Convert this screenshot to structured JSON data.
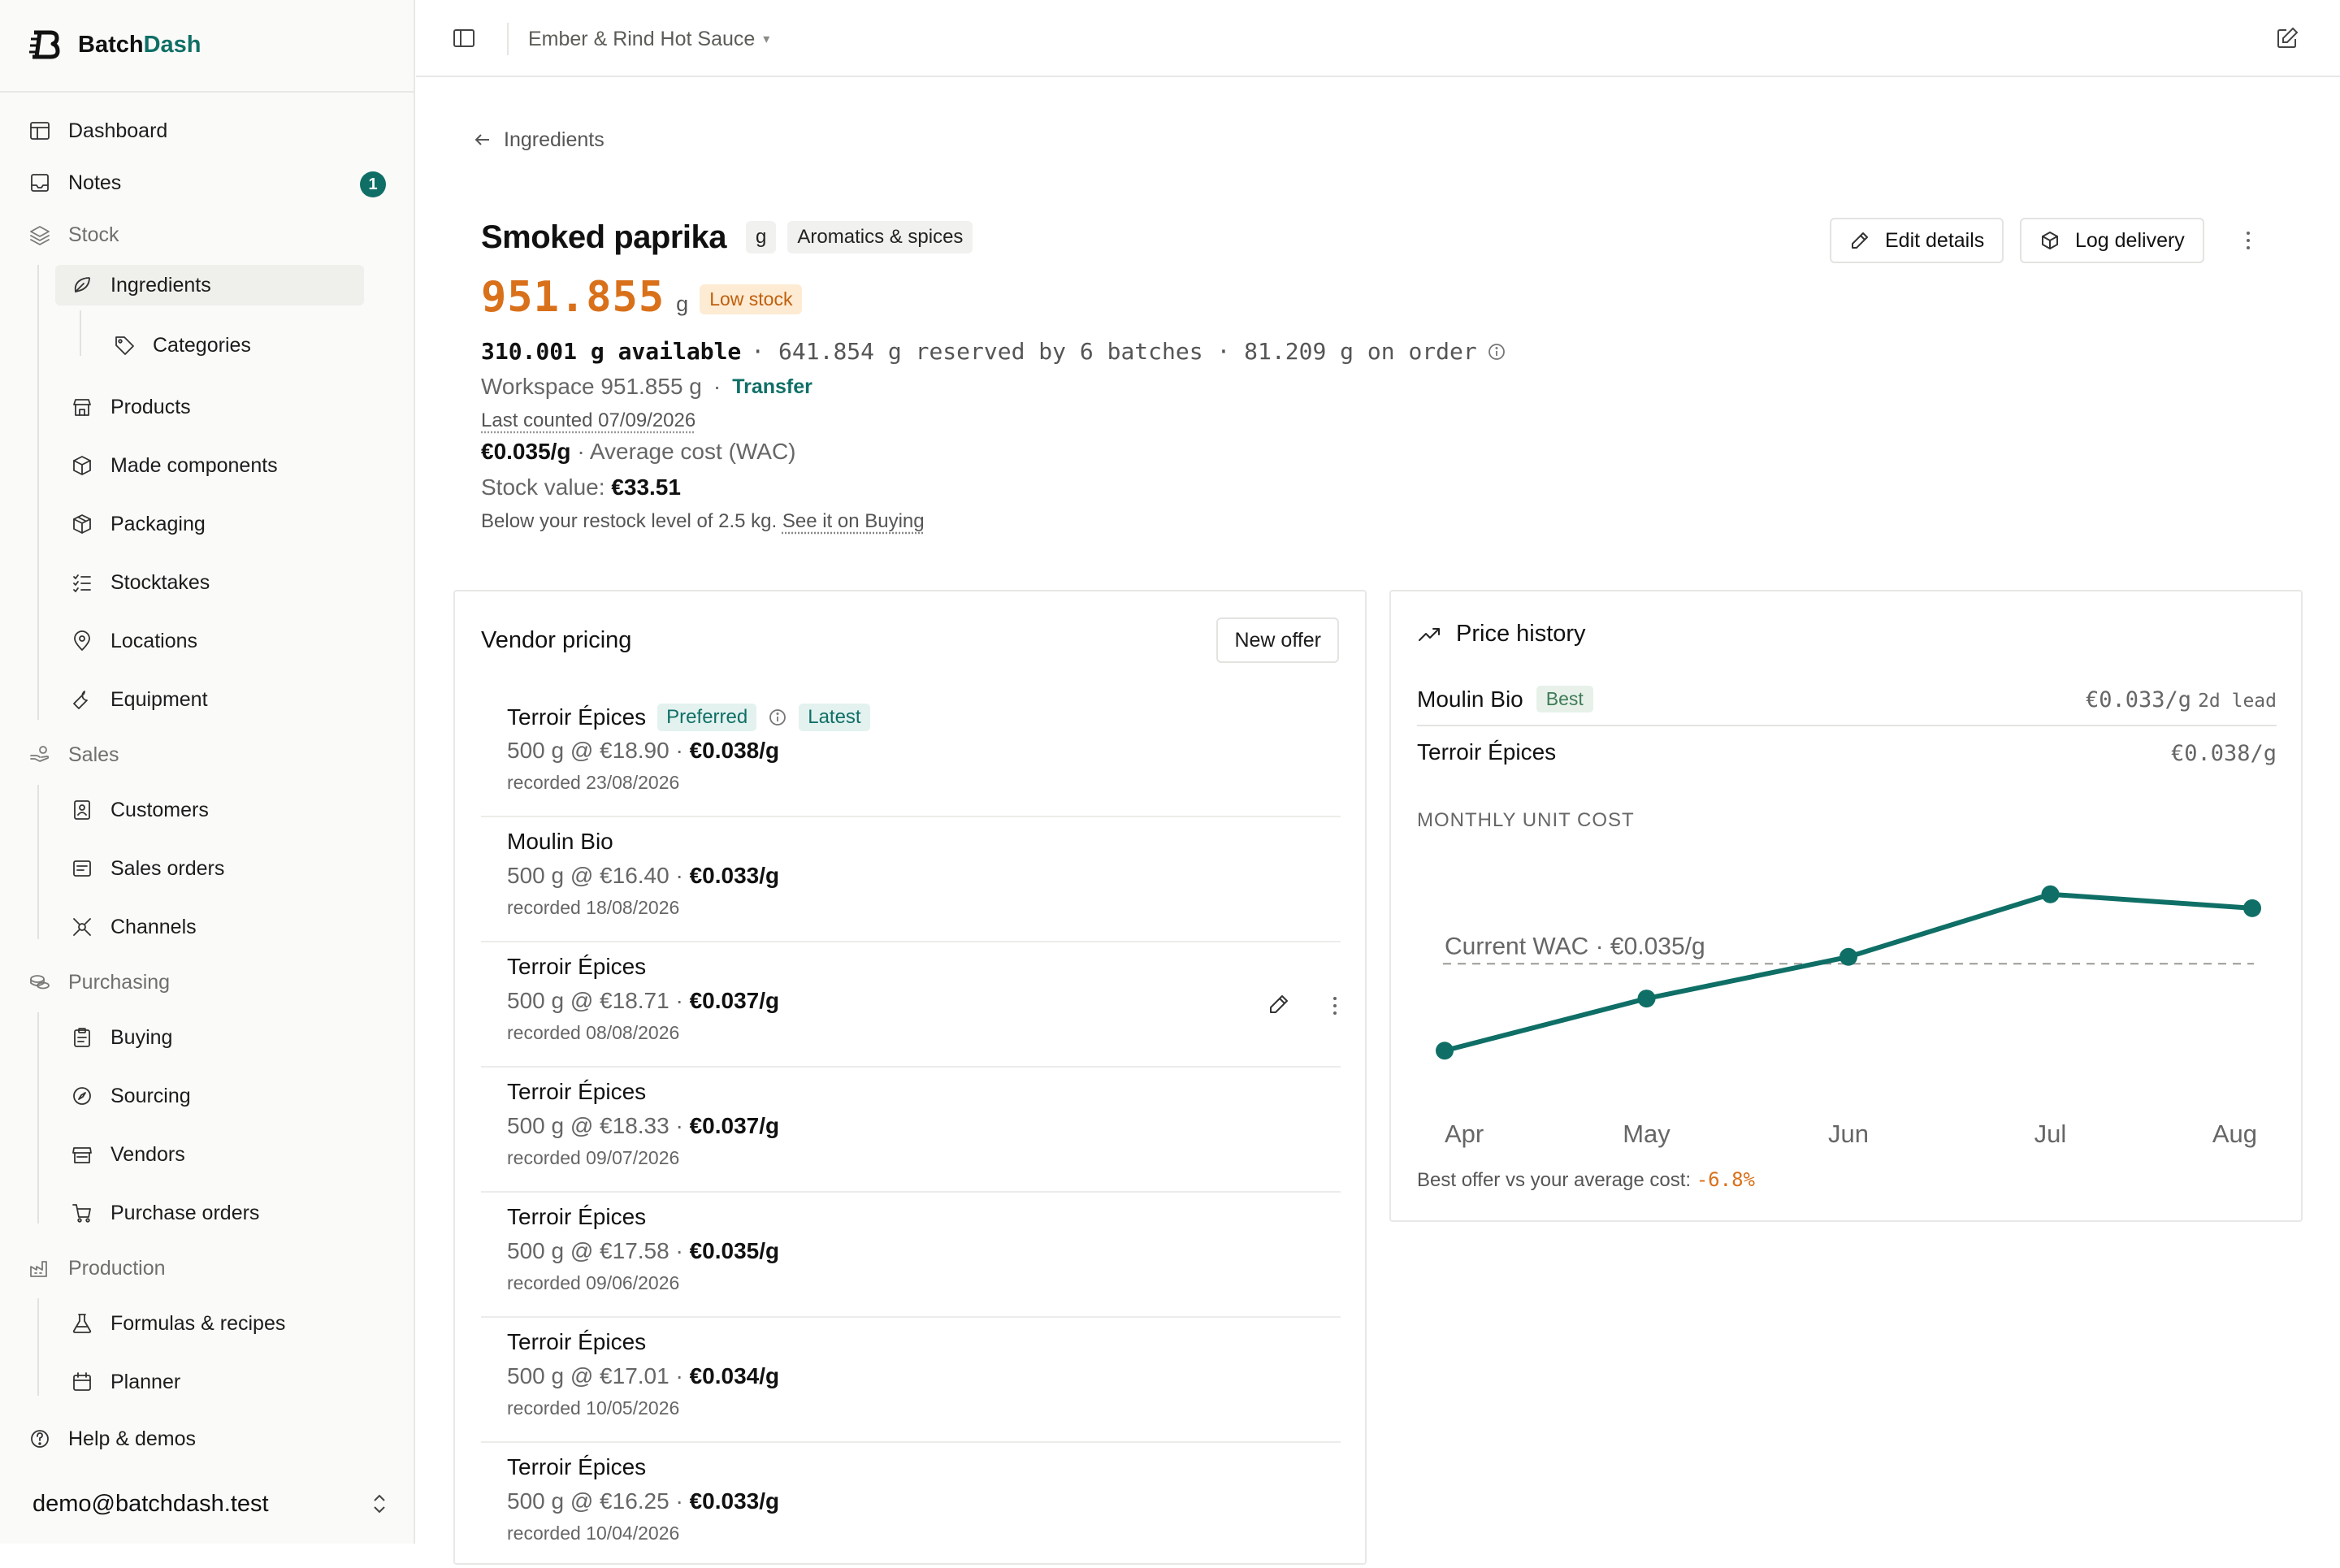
{
  "app": {
    "brand_first": "Batch",
    "brand_second": "Dash",
    "workspace": "Ember & Rind Hot Sauce",
    "user_email": "demo@batchdash.test"
  },
  "sidebar": {
    "dashboard": "Dashboard",
    "notes": "Notes",
    "notes_count": "1",
    "stock": "Stock",
    "ingredients": "Ingredients",
    "categories": "Categories",
    "products": "Products",
    "made_components": "Made components",
    "packaging": "Packaging",
    "stocktakes": "Stocktakes",
    "locations": "Locations",
    "equipment": "Equipment",
    "sales": "Sales",
    "customers": "Customers",
    "sales_orders": "Sales orders",
    "channels": "Channels",
    "purchasing": "Purchasing",
    "buying": "Buying",
    "sourcing": "Sourcing",
    "vendors": "Vendors",
    "purchase_orders": "Purchase orders",
    "production": "Production",
    "formulas": "Formulas & recipes",
    "planner": "Planner",
    "help": "Help & demos"
  },
  "page": {
    "back_label": "Ingredients",
    "title": "Smoked paprika",
    "unit_chip": "g",
    "category_chip": "Aromatics & spices",
    "quantity": "951.855",
    "quantity_unit": "g",
    "stock_status": "Low stock",
    "available": "310.001 g available",
    "reserved": "· 641.854 g reserved by 6 batches · 81.209 g on order",
    "workspace_stock": "Workspace 951.855 g",
    "dot": "·",
    "transfer": "Transfer",
    "last_counted": "Last counted 07/09/2026",
    "wac_value": "€0.035/g",
    "wac_label": "· Average cost (WAC)",
    "stock_value_label": "Stock value:",
    "stock_value": "€33.51",
    "restock_text": "Below your restock level of 2.5 kg.",
    "restock_link": "See it on Buying",
    "edit_details": "Edit details",
    "log_delivery": "Log delivery"
  },
  "vendor_pricing": {
    "title": "Vendor pricing",
    "new_offer": "New offer",
    "preferred_tag": "Preferred",
    "latest_tag": "Latest",
    "offers": [
      {
        "vendor": "Terroir Épices",
        "price": "500 g @ €18.90 ·",
        "unit": "€0.038/g",
        "recorded": "recorded 23/08/2026"
      },
      {
        "vendor": "Moulin Bio",
        "price": "500 g @ €16.40 ·",
        "unit": "€0.033/g",
        "recorded": "recorded 18/08/2026"
      },
      {
        "vendor": "Terroir Épices",
        "price": "500 g @ €18.71 ·",
        "unit": "€0.037/g",
        "recorded": "recorded 08/08/2026"
      },
      {
        "vendor": "Terroir Épices",
        "price": "500 g @ €18.33 ·",
        "unit": "€0.037/g",
        "recorded": "recorded 09/07/2026"
      },
      {
        "vendor": "Terroir Épices",
        "price": "500 g @ €17.58 ·",
        "unit": "€0.035/g",
        "recorded": "recorded 09/06/2026"
      },
      {
        "vendor": "Terroir Épices",
        "price": "500 g @ €17.01 ·",
        "unit": "€0.034/g",
        "recorded": "recorded 10/05/2026"
      },
      {
        "vendor": "Terroir Épices",
        "price": "500 g @ €16.25 ·",
        "unit": "€0.033/g",
        "recorded": "recorded 10/04/2026"
      }
    ]
  },
  "price_history": {
    "title": "Price history",
    "best_tag": "Best",
    "rows": [
      {
        "vendor": "Moulin Bio",
        "price": "€0.033/g",
        "lead": "2d lead"
      },
      {
        "vendor": "Terroir Épices",
        "price": "€0.038/g",
        "lead": ""
      }
    ],
    "section_label": "MONTHLY UNIT COST",
    "best_note": "Best offer vs your average cost:",
    "best_delta": "-6.8%"
  },
  "chart_data": {
    "type": "line",
    "x": [
      "Apr",
      "May",
      "Jun",
      "Jul",
      "Aug"
    ],
    "series": [
      {
        "values": [
          0.0325,
          0.034,
          0.0352,
          0.037,
          0.0366
        ]
      }
    ],
    "reference_line": {
      "label": "Current WAC · €0.035/g",
      "value": 0.035
    },
    "ylim": [
      0.0315,
      0.038
    ],
    "grid": false,
    "color": "#0f6f66"
  }
}
